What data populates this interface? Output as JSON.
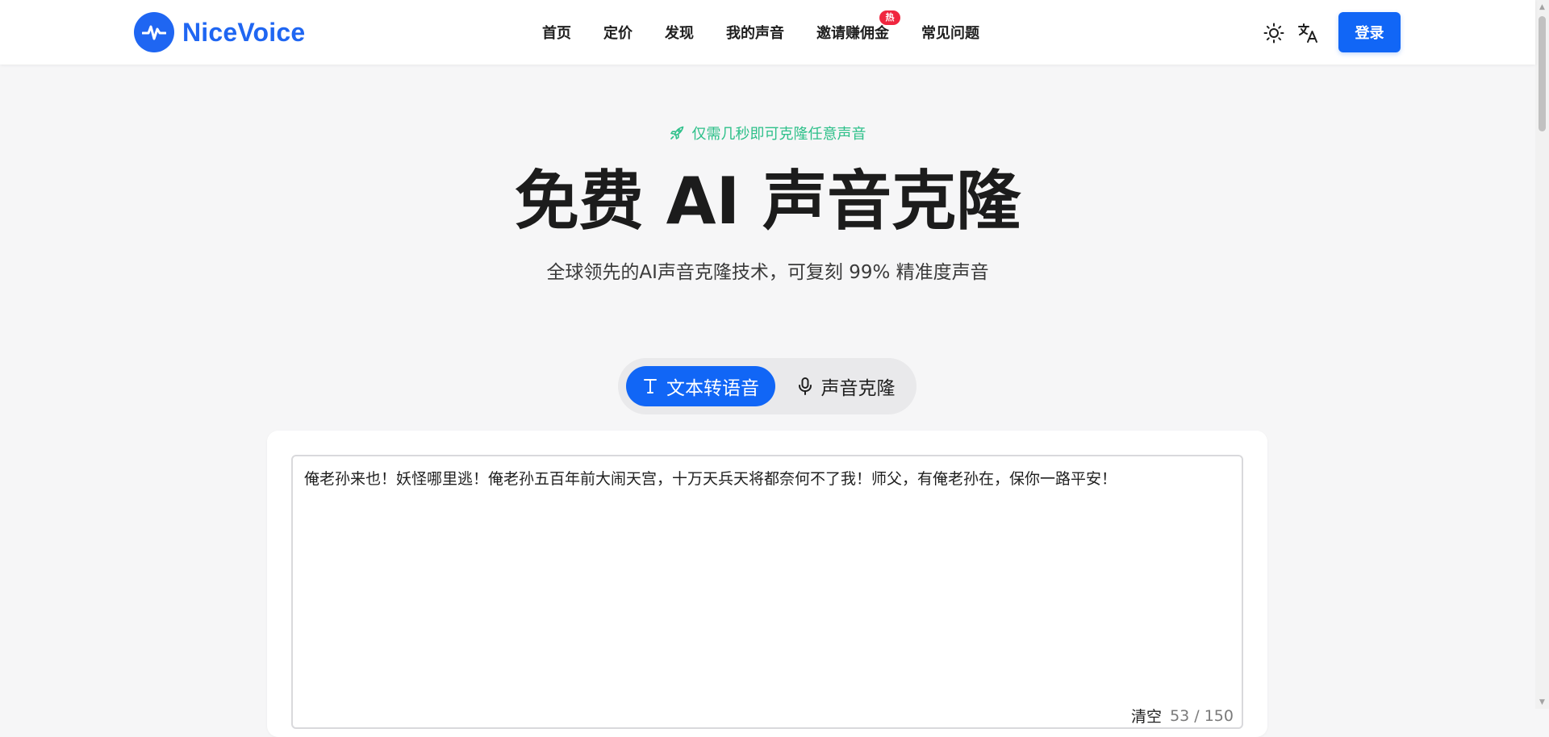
{
  "brand": {
    "name": "NiceVoice",
    "color": "#1f66f2"
  },
  "nav": {
    "items": [
      {
        "label": "首页"
      },
      {
        "label": "定价"
      },
      {
        "label": "发现"
      },
      {
        "label": "我的声音"
      },
      {
        "label": "邀请赚佣金",
        "badge": "热"
      },
      {
        "label": "常见问题"
      }
    ]
  },
  "header": {
    "theme_icon": "sun-icon",
    "language_icon": "translate-icon",
    "login_label": "登录"
  },
  "hero": {
    "tag": "仅需几秒即可克隆任意声音",
    "tag_icon": "rocket-icon",
    "tag_color": "#2ec08a",
    "title": "免费 AI 声音克隆",
    "subtitle": "全球领先的AI声音克隆技术，可复刻 99% 精准度声音"
  },
  "mode_tabs": [
    {
      "label": "文本转语音",
      "icon": "text-icon",
      "active": true
    },
    {
      "label": "声音克隆",
      "icon": "microphone-icon",
      "active": false
    }
  ],
  "editor": {
    "text": "俺老孙来也！妖怪哪里逃！俺老孙五百年前大闹天宫，十万天兵天将都奈何不了我！师父，有俺老孙在，保你一路平安！",
    "clear_label": "清空",
    "char_count": "53 / 150"
  },
  "accent_color": "#1166f6"
}
